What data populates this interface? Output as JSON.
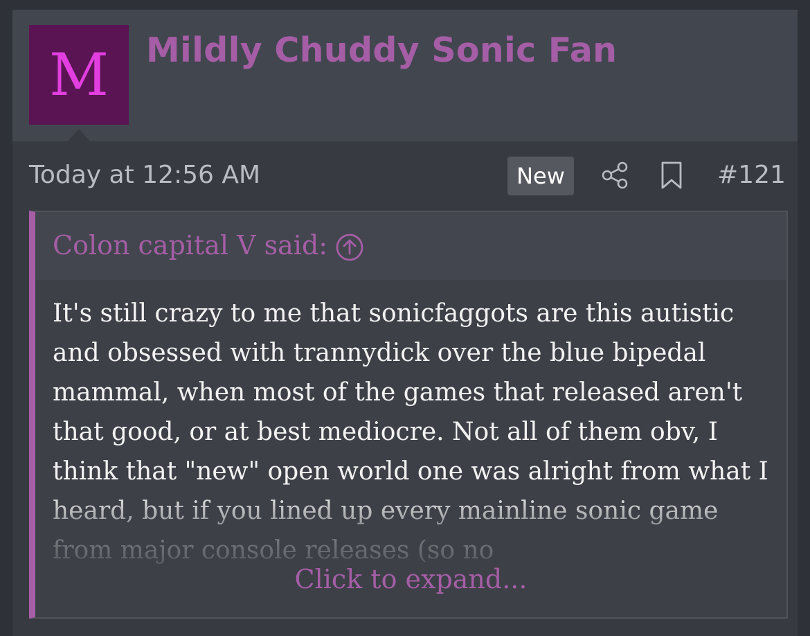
{
  "post": {
    "avatar_letter": "M",
    "username": "Mildly Chuddy Sonic Fan",
    "timestamp": "Today at 12:56 AM",
    "new_badge": "New",
    "post_number": "#121",
    "icons": {
      "share": "share-icon",
      "bookmark": "bookmark-icon",
      "quote_up": "arrow-up-circle-icon"
    },
    "colors": {
      "accent": "#a55ea6",
      "avatar_bg": "#5a1453",
      "avatar_letter": "#e23ee0"
    }
  },
  "quote": {
    "author_line": "Colon capital V said:",
    "text": "It's still crazy to me that sonicfaggots are this autistic and obsessed with trannydick over the blue bipedal mammal, when most of the games that released aren't that good, or at best mediocre. Not all of them obv, I think that \"new\" open world one was alright from what I heard, but if you lined up every mainline sonic game from major console releases (so no",
    "expand_label": "Click to expand..."
  }
}
